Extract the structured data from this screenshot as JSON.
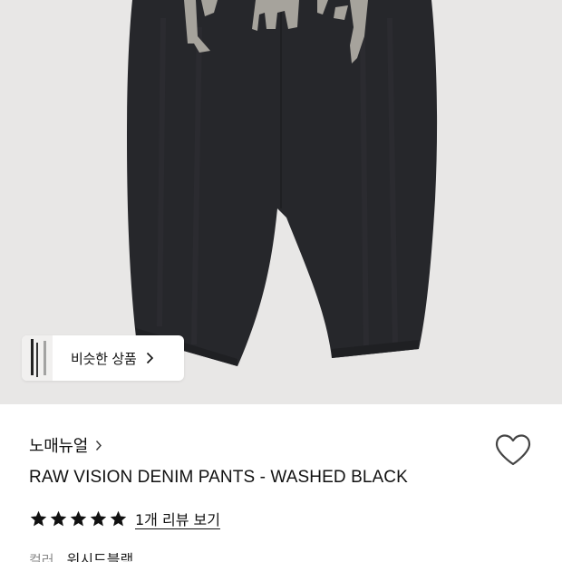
{
  "image": {
    "background": "#e8e7e6",
    "product_color": "#25262a",
    "print_color": "#a6a39c"
  },
  "similar": {
    "label": "비슷한 상품",
    "icon": "chevron-right-icon"
  },
  "brand": {
    "name": "노매뉴얼",
    "icon": "chevron-right-icon"
  },
  "wishlist": {
    "icon": "heart-outline-icon"
  },
  "product": {
    "title": "RAW VISION DENIM PANTS - WASHED BLACK"
  },
  "rating": {
    "stars": 5,
    "max": 5,
    "star_color": "#111111",
    "review_link": "1개 리뷰 보기"
  },
  "option": {
    "label": "컬러",
    "value": "워시드블랙"
  }
}
